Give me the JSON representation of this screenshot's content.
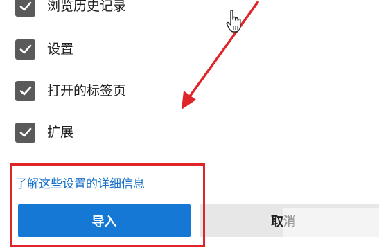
{
  "options": [
    {
      "label": "浏览历史记录",
      "checked": true
    },
    {
      "label": "设置",
      "checked": true
    },
    {
      "label": "打开的标签页",
      "checked": true
    },
    {
      "label": "扩展",
      "checked": true
    }
  ],
  "learn_more_link": "了解这些设置的详细信息",
  "buttons": {
    "import_label": "导入",
    "cancel_label": "取消"
  },
  "colors": {
    "primary": "#1478d4",
    "link": "#1a73c9",
    "checkbox": "#5a5a5a",
    "annotation": "#e0242a"
  },
  "icons": {
    "checkmark": "check-icon",
    "cursor": "hand-pointer-icon"
  }
}
